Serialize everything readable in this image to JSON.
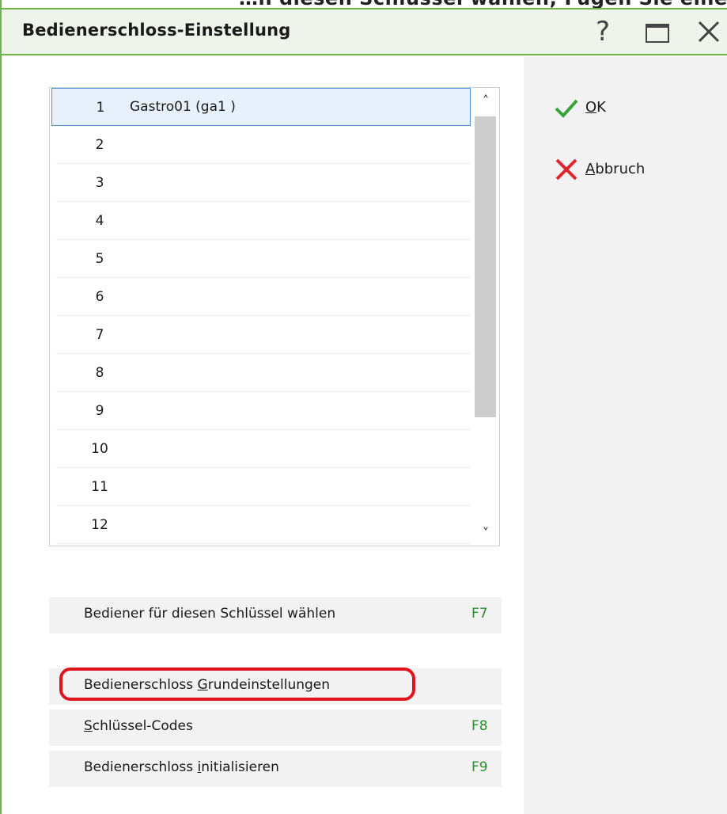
{
  "window": {
    "title": "Bedienerschloss-Einstellung",
    "top_cut_text": "…h diesen Schlüssel wählen; Fügen Sie eine Anmerkung hinzu …",
    "help_label": "?",
    "accent_color": "#6fb34a"
  },
  "list": {
    "rows": [
      {
        "num": "1",
        "name": "Gastro01 (ga1 )"
      },
      {
        "num": "2",
        "name": ""
      },
      {
        "num": "3",
        "name": ""
      },
      {
        "num": "4",
        "name": ""
      },
      {
        "num": "5",
        "name": ""
      },
      {
        "num": "6",
        "name": ""
      },
      {
        "num": "7",
        "name": ""
      },
      {
        "num": "8",
        "name": ""
      },
      {
        "num": "9",
        "name": ""
      },
      {
        "num": "10",
        "name": ""
      },
      {
        "num": "11",
        "name": ""
      },
      {
        "num": "12",
        "name": ""
      }
    ],
    "selected_row": "1"
  },
  "actions": {
    "choose_operator": {
      "label": "Bediener für diesen Schlüssel wählen",
      "key": "F7"
    },
    "basic_settings": {
      "before": "Bedienerschloss ",
      "mnemonic": "G",
      "after": "rundeinstellungen",
      "key": ""
    },
    "key_codes": {
      "before": "",
      "mnemonic": "S",
      "after": "chlüssel-Codes",
      "key": "F8"
    },
    "initialize": {
      "before": "Bedienerschloss ",
      "mnemonic": "i",
      "after": "nitialisieren",
      "key": "F9"
    }
  },
  "side": {
    "ok": {
      "mnemonic": "O",
      "after": "K",
      "icon": "check-icon",
      "color": "#3aa23a"
    },
    "cancel": {
      "mnemonic": "A",
      "after": "bbruch",
      "icon": "close-icon",
      "color": "#e0242e"
    }
  },
  "icons": {
    "scroll_up": "˄",
    "scroll_down": "˅"
  }
}
